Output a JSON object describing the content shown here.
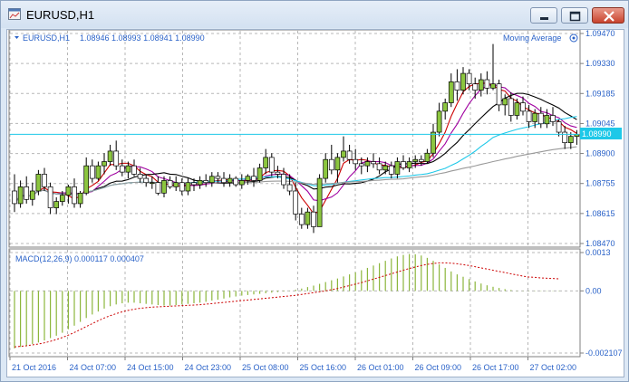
{
  "window": {
    "title": "EURUSD,H1",
    "icon": "chart-window-icon",
    "buttons": [
      "minimize-icon",
      "restore-icon",
      "close-icon"
    ]
  },
  "main_pane": {
    "symbol_label": "EURUSD,H1",
    "ohlc_label": "1.08946 1.08993 1.08941 1.08990",
    "indicator_label": "Moving Average",
    "current_price": "1.08990",
    "price_axis": [
      "1.09470",
      "1.09330",
      "1.09185",
      "1.09045",
      "1.08900",
      "1.08755",
      "1.08615",
      "1.08470"
    ]
  },
  "macd_pane": {
    "label": "MACD(12,26,9) 0.000117 0.000407",
    "axis": [
      "0.0013",
      "0.00",
      "-0.002107"
    ]
  },
  "time_axis": [
    "21 Oct 2016",
    "24 Oct 07:00",
    "24 Oct 15:00",
    "24 Oct 23:00",
    "25 Oct 08:00",
    "25 Oct 16:00",
    "26 Oct 01:00",
    "26 Oct 09:00",
    "26 Oct 17:00",
    "27 Oct 02:00"
  ],
  "colors": {
    "up_candle": "#8cc63f",
    "down_candle": "#ffffff",
    "grid": "#b7b7b7",
    "ma_black": "#000000",
    "ma_red": "#cc0000",
    "ma_magenta": "#a000a0",
    "ma_cyan": "#1ec8e8",
    "ma_gray": "#999999",
    "macd_hist": "#8cb63c",
    "macd_signal": "#cc0000",
    "price_line": "#1ec8e8"
  },
  "chart_data": {
    "type": "candlestick",
    "symbol": "EURUSD",
    "timeframe": "H1",
    "ylim": [
      1.0847,
      1.0947
    ],
    "current_price": 1.0899,
    "candles": [
      [
        1.0872,
        1.088,
        1.0862,
        1.0866
      ],
      [
        1.0866,
        1.0877,
        1.0864,
        1.0874
      ],
      [
        1.0874,
        1.0879,
        1.0866,
        1.0868
      ],
      [
        1.0868,
        1.0876,
        1.0865,
        1.0872
      ],
      [
        1.0872,
        1.0882,
        1.087,
        1.088
      ],
      [
        1.088,
        1.0883,
        1.0872,
        1.0874
      ],
      [
        1.0874,
        1.0876,
        1.0861,
        1.0864
      ],
      [
        1.0864,
        1.0869,
        1.0861,
        1.0867
      ],
      [
        1.0867,
        1.0872,
        1.0865,
        1.087
      ],
      [
        1.087,
        1.0875,
        1.0866,
        1.0874
      ],
      [
        1.0874,
        1.0878,
        1.0864,
        1.0866
      ],
      [
        1.0866,
        1.0872,
        1.0864,
        1.0871
      ],
      [
        1.0871,
        1.0888,
        1.087,
        1.0884
      ],
      [
        1.0884,
        1.0887,
        1.0876,
        1.0878
      ],
      [
        1.0878,
        1.0886,
        1.0877,
        1.0884
      ],
      [
        1.0884,
        1.089,
        1.088,
        1.0886
      ],
      [
        1.0886,
        1.0894,
        1.0884,
        1.0891
      ],
      [
        1.0891,
        1.0896,
        1.0882,
        1.0884
      ],
      [
        1.0884,
        1.0887,
        1.0879,
        1.0881
      ],
      [
        1.0881,
        1.0886,
        1.0878,
        1.0884
      ],
      [
        1.0884,
        1.0887,
        1.0879,
        1.088
      ],
      [
        1.088,
        1.0883,
        1.0876,
        1.0878
      ],
      [
        1.0878,
        1.088,
        1.0874,
        1.0876
      ],
      [
        1.0876,
        1.0879,
        1.0873,
        1.0876
      ],
      [
        1.0876,
        1.0879,
        1.087,
        1.0871
      ],
      [
        1.0871,
        1.0879,
        1.0869,
        1.0877
      ],
      [
        1.0877,
        1.0879,
        1.0873,
        1.0874
      ],
      [
        1.0874,
        1.0879,
        1.0872,
        1.0876
      ],
      [
        1.0876,
        1.0878,
        1.087,
        1.0872
      ],
      [
        1.0872,
        1.0878,
        1.087,
        1.0876
      ],
      [
        1.0876,
        1.0878,
        1.0872,
        1.0875
      ],
      [
        1.0875,
        1.0879,
        1.0873,
        1.0877
      ],
      [
        1.0877,
        1.088,
        1.0874,
        1.0876
      ],
      [
        1.0876,
        1.0881,
        1.0874,
        1.0879
      ],
      [
        1.0879,
        1.0881,
        1.0876,
        1.0878
      ],
      [
        1.0878,
        1.0881,
        1.0874,
        1.0876
      ],
      [
        1.0876,
        1.088,
        1.0874,
        1.0878
      ],
      [
        1.0878,
        1.0879,
        1.0874,
        1.0875
      ],
      [
        1.0875,
        1.088,
        1.0873,
        1.0877
      ],
      [
        1.0877,
        1.088,
        1.0875,
        1.0879
      ],
      [
        1.0879,
        1.0883,
        1.0874,
        1.0877
      ],
      [
        1.0877,
        1.0885,
        1.0876,
        1.0883
      ],
      [
        1.0883,
        1.0892,
        1.088,
        1.0888
      ],
      [
        1.0888,
        1.089,
        1.0879,
        1.0881
      ],
      [
        1.0881,
        1.0884,
        1.0878,
        1.088
      ],
      [
        1.088,
        1.0883,
        1.0873,
        1.0875
      ],
      [
        1.0875,
        1.088,
        1.087,
        1.0872
      ],
      [
        1.0872,
        1.0876,
        1.0858,
        1.0861
      ],
      [
        1.0861,
        1.0864,
        1.0854,
        1.0856
      ],
      [
        1.0856,
        1.0864,
        1.0854,
        1.0862
      ],
      [
        1.0862,
        1.0865,
        1.0852,
        1.0855
      ],
      [
        1.0855,
        1.088,
        1.0855,
        1.0878
      ],
      [
        1.0878,
        1.089,
        1.0876,
        1.0887
      ],
      [
        1.0887,
        1.0894,
        1.088,
        1.0882
      ],
      [
        1.0882,
        1.089,
        1.0876,
        1.0888
      ],
      [
        1.0888,
        1.0898,
        1.0886,
        1.0891
      ],
      [
        1.0891,
        1.0894,
        1.0885,
        1.0887
      ],
      [
        1.0887,
        1.0892,
        1.0882,
        1.0885
      ],
      [
        1.0885,
        1.0888,
        1.088,
        1.0884
      ],
      [
        1.0884,
        1.0888,
        1.0881,
        1.0886
      ],
      [
        1.0886,
        1.089,
        1.0883,
        1.0885
      ],
      [
        1.0885,
        1.0888,
        1.088,
        1.0882
      ],
      [
        1.0882,
        1.0886,
        1.088,
        1.0884
      ],
      [
        1.0884,
        1.0886,
        1.0878,
        1.088
      ],
      [
        1.088,
        1.0888,
        1.0878,
        1.0886
      ],
      [
        1.0886,
        1.0889,
        1.0882,
        1.0883
      ],
      [
        1.0883,
        1.0888,
        1.0881,
        1.0886
      ],
      [
        1.0886,
        1.0889,
        1.0883,
        1.0887
      ],
      [
        1.0887,
        1.0889,
        1.0884,
        1.0886
      ],
      [
        1.0886,
        1.0892,
        1.0885,
        1.089
      ],
      [
        1.089,
        1.0904,
        1.0888,
        1.09
      ],
      [
        1.09,
        1.0914,
        1.0898,
        1.091
      ],
      [
        1.091,
        1.0916,
        1.0906,
        1.0914
      ],
      [
        1.0914,
        1.0928,
        1.0912,
        1.0924
      ],
      [
        1.0924,
        1.093,
        1.0915,
        1.092
      ],
      [
        1.092,
        1.0931,
        1.0918,
        1.0928
      ],
      [
        1.0928,
        1.093,
        1.092,
        1.0923
      ],
      [
        1.0923,
        1.0926,
        1.0916,
        1.092
      ],
      [
        1.092,
        1.0928,
        1.0917,
        1.0925
      ],
      [
        1.0925,
        1.0929,
        1.0918,
        1.0921
      ],
      [
        1.0921,
        1.0942,
        1.092,
        1.0923
      ],
      [
        1.0923,
        1.0925,
        1.091,
        1.0913
      ],
      [
        1.0913,
        1.0918,
        1.0908,
        1.0916
      ],
      [
        1.0916,
        1.0919,
        1.0905,
        1.0908
      ],
      [
        1.0908,
        1.0916,
        1.0906,
        1.0914
      ],
      [
        1.0914,
        1.0917,
        1.0908,
        1.091
      ],
      [
        1.091,
        1.0913,
        1.0902,
        1.0905
      ],
      [
        1.0905,
        1.0911,
        1.0902,
        1.0909
      ],
      [
        1.0909,
        1.0912,
        1.0902,
        1.0904
      ],
      [
        1.0904,
        1.0911,
        1.0902,
        1.0908
      ],
      [
        1.0908,
        1.0912,
        1.0903,
        1.0905
      ],
      [
        1.0905,
        1.0906,
        1.0898,
        1.09
      ],
      [
        1.09,
        1.0903,
        1.0892,
        1.0895
      ],
      [
        1.0895,
        1.09,
        1.0892,
        1.0898
      ],
      [
        1.0898,
        1.0901,
        1.0894,
        1.0899
      ]
    ],
    "macd": {
      "histogram": [
        -0.00195,
        -0.0019,
        -0.00185,
        -0.0018,
        -0.00175,
        -0.00168,
        -0.0016,
        -0.00152,
        -0.00142,
        -0.0013,
        -0.00118,
        -0.00105,
        -0.00092,
        -0.0008,
        -0.0007,
        -0.0006,
        -0.00052,
        -0.00046,
        -0.00042,
        -0.0004,
        -0.0004,
        -0.00042,
        -0.00044,
        -0.00046,
        -0.00048,
        -0.0005,
        -0.0005,
        -0.00048,
        -0.00046,
        -0.00044,
        -0.00042,
        -0.0004,
        -0.00037,
        -0.00033,
        -0.0003,
        -0.00026,
        -0.00022,
        -0.00019,
        -0.00016,
        -0.00014,
        -0.00012,
        -0.0001,
        -8e-05,
        -6e-05,
        -4e-05,
        -2e-05,
        1e-05,
        4e-05,
        8e-05,
        0.00013,
        0.00018,
        0.00024,
        0.0003,
        0.00036,
        0.00042,
        0.00049,
        0.00056,
        0.00063,
        0.0007,
        0.00078,
        0.00086,
        0.00094,
        0.00102,
        0.0011,
        0.00117,
        0.00122,
        0.00125,
        0.00124,
        0.0012,
        0.00112,
        0.00102,
        0.0009,
        0.00078,
        0.00066,
        0.00056,
        0.00048,
        0.0004,
        0.00032,
        0.00025,
        0.00019,
        0.00014,
        0.0001,
        6e-05,
        3e-05,
        1e-05,
        1e-05,
        1e-05,
        1e-05,
        1e-05,
        1e-05,
        1e-05,
        1e-05
      ],
      "signal": [
        -0.0019,
        -0.00188,
        -0.00186,
        -0.00183,
        -0.0018,
        -0.00176,
        -0.00171,
        -0.00165,
        -0.00158,
        -0.0015,
        -0.00141,
        -0.00131,
        -0.00121,
        -0.00111,
        -0.00101,
        -0.00092,
        -0.00084,
        -0.00077,
        -0.00071,
        -0.00066,
        -0.00062,
        -0.00059,
        -0.00057,
        -0.00055,
        -0.00054,
        -0.00053,
        -0.00052,
        -0.00051,
        -0.0005,
        -0.00049,
        -0.00048,
        -0.00047,
        -0.00045,
        -0.00043,
        -0.00041,
        -0.00039,
        -0.00037,
        -0.00035,
        -0.00033,
        -0.00031,
        -0.00029,
        -0.00027,
        -0.00025,
        -0.00023,
        -0.00021,
        -0.00019,
        -0.00017,
        -0.00015,
        -0.00012,
        -9e-05,
        -6e-05,
        -3e-05,
        0.0,
        4e-05,
        8e-05,
        0.00013,
        0.00018,
        0.00023,
        0.00028,
        0.00034,
        0.0004,
        0.00046,
        0.00052,
        0.00058,
        0.00064,
        0.0007,
        0.00076,
        0.00081,
        0.00086,
        0.0009,
        0.00093,
        0.00095,
        0.00095,
        0.00094,
        0.00092,
        0.00089,
        0.00086,
        0.00082,
        0.00078,
        0.00074,
        0.0007,
        0.00066,
        0.00062,
        0.00058,
        0.00054,
        0.0005,
        0.00047,
        0.00046,
        0.00044,
        0.00043,
        0.00042,
        0.00041
      ],
      "ylim": [
        -0.002107,
        0.0013
      ]
    }
  }
}
